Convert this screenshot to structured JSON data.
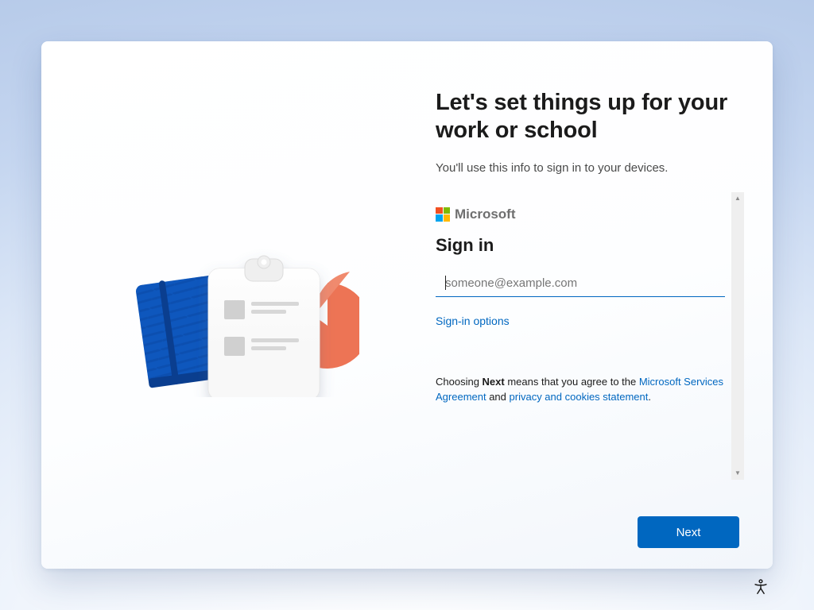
{
  "heading": "Let's set things up for your work or school",
  "subtext": "You'll use this info to sign in to your devices.",
  "brand": {
    "name": "Microsoft"
  },
  "signin": {
    "title": "Sign in",
    "email_value": "",
    "email_placeholder": "someone@example.com",
    "options_label": "Sign-in options"
  },
  "legal": {
    "prefix": "Choosing ",
    "bold": "Next",
    "middle": " means that you agree to the ",
    "link1": "Microsoft Services Agreement",
    "and": " and ",
    "link2": "privacy and cookies statement",
    "suffix": "."
  },
  "buttons": {
    "next": "Next"
  }
}
